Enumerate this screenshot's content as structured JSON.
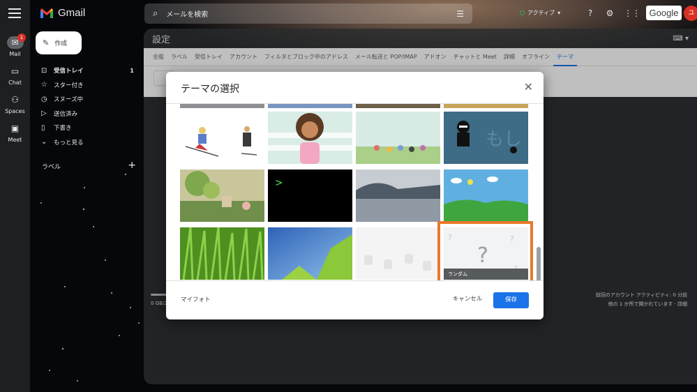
{
  "app": {
    "name": "Gmail"
  },
  "rail": {
    "items": [
      {
        "label": "Mail",
        "badge": "1"
      },
      {
        "label": "Chat"
      },
      {
        "label": "Spaces"
      },
      {
        "label": "Meet"
      }
    ]
  },
  "header": {
    "search_placeholder": "メールを検索",
    "status": "アクティブ",
    "google_label": "Google",
    "avatar_initial": "ユ"
  },
  "nav": {
    "compose_label": "作成",
    "items": [
      {
        "label": "受信トレイ",
        "count": "1"
      },
      {
        "label": "スター付き"
      },
      {
        "label": "スヌーズ中"
      },
      {
        "label": "送信済み"
      },
      {
        "label": "下書き"
      },
      {
        "label": "もっと見る"
      }
    ],
    "labels_heading": "ラベル"
  },
  "settings": {
    "title": "設定",
    "tabs": [
      "全般",
      "ラベル",
      "受信トレイ",
      "アカウント",
      "フィルタとブロック中のアドレス",
      "メール転送と POP/IMAP",
      "アドオン",
      "チャットと Meet",
      "詳細",
      "オフライン",
      "テーマ"
    ],
    "active_tab": "テーマ",
    "storage_text": "0 GB/2",
    "activity_line1": "前回のアカウント アクティビティ: 0 分前",
    "activity_line2": "他の 1 か所で開かれています · 詳細"
  },
  "dialog": {
    "title": "テーマの選択",
    "themes": [
      {
        "name": "skier"
      },
      {
        "name": "girl"
      },
      {
        "name": "park-kids"
      },
      {
        "name": "ninja"
      },
      {
        "name": "garden"
      },
      {
        "name": "terminal"
      },
      {
        "name": "lake"
      },
      {
        "name": "green-hills"
      },
      {
        "name": "grass"
      },
      {
        "name": "leaves"
      },
      {
        "name": "android"
      },
      {
        "name": "random",
        "caption": "ランダム",
        "selected": true
      }
    ],
    "my_photos_label": "マイフォト",
    "cancel_label": "キャンセル",
    "save_label": "保存"
  },
  "colors": {
    "accent": "#1a73e8",
    "selection": "#e8792b",
    "badge": "#d93025"
  }
}
